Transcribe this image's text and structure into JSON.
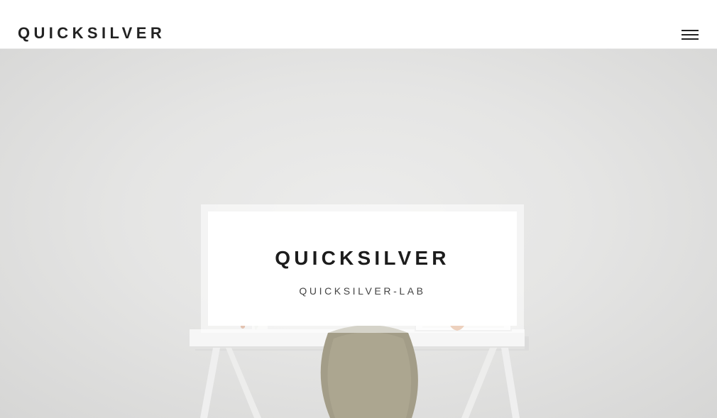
{
  "navbar": {
    "brand": "QUICKSILVER",
    "menu_icon": "hamburger-menu-icon"
  },
  "hero": {
    "title": "QUICKSILVER",
    "subtitle": "QUICKSILVER-LAB"
  },
  "colors": {
    "text_dark": "#222222",
    "hero_wall": "#e5e5e4",
    "desk": "#f7f7f7",
    "chair": "#a7a08a",
    "vase_copper": "#c07a52"
  }
}
